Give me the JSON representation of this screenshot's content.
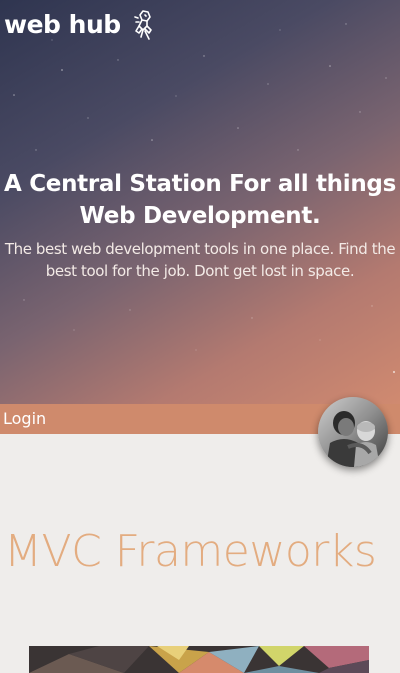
{
  "header": {
    "brand": "web hub",
    "brand_icon": "rocket-icon"
  },
  "hero": {
    "title": "A Central Station For all things Web Development.",
    "subtitle": "The best web development tools in one place. Find the best tool for the job. Dont get lost in space."
  },
  "login_bar": {
    "login_label": "Login",
    "avatar_icon": "user-avatar"
  },
  "section": {
    "title": "MVC Frameworks"
  },
  "colors": {
    "accent": "#cf8a6c",
    "section_title": "#e3ac80",
    "background": "#efedeb"
  }
}
